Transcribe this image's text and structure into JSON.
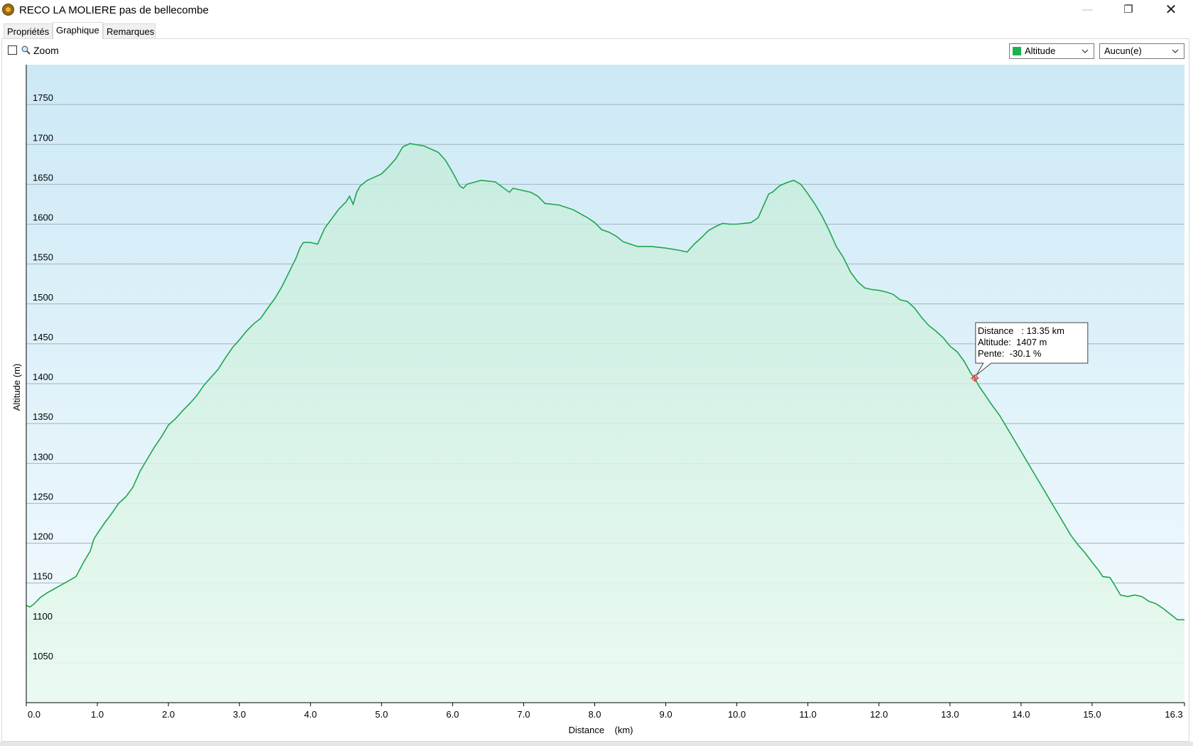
{
  "window": {
    "title": "RECO LA MOLIERE pas de bellecombe",
    "minimize": "—",
    "maximize": "❐",
    "close": "✕"
  },
  "tabs": [
    {
      "label": "Propriétés",
      "active": false
    },
    {
      "label": "Graphique",
      "active": true
    },
    {
      "label": "Remarques",
      "active": false
    }
  ],
  "toolbar": {
    "zoom_label": "Zoom",
    "zoom_checked": false,
    "series_select": {
      "value": "Altitude",
      "color": "#1bb24c"
    },
    "secondary_select": {
      "value": "Aucun(e)"
    }
  },
  "colors": {
    "line": "#1ea64a",
    "fill_top": "#c4ecda",
    "fill_bottom": "#eafaef",
    "bg_top": "#cde9f6",
    "bg_bottom": "#f4fbfe",
    "grid": "#9fb4bd",
    "marker": "#e03030"
  },
  "chart_data": {
    "type": "area",
    "xlabel": "Distance    (km)",
    "ylabel": "Altitude  (m)",
    "xlim": [
      0,
      16.3
    ],
    "ylim": [
      1000,
      1800
    ],
    "x_ticks": [
      "0.0",
      "1.0",
      "2.0",
      "3.0",
      "4.0",
      "5.0",
      "6.0",
      "7.0",
      "8.0",
      "9.0",
      "10.0",
      "11.0",
      "12.0",
      "13.0",
      "14.0",
      "15.0",
      "16.3"
    ],
    "y_ticks": [
      "1050",
      "1100",
      "1150",
      "1200",
      "1250",
      "1300",
      "1350",
      "1400",
      "1450",
      "1500",
      "1550",
      "1600",
      "1650",
      "1700",
      "1750"
    ],
    "grid": true,
    "series": [
      {
        "values": [
          [
            0.0,
            1122
          ],
          [
            0.05,
            1120
          ],
          [
            0.1,
            1123
          ],
          [
            0.2,
            1132
          ],
          [
            0.3,
            1138
          ],
          [
            0.4,
            1143
          ],
          [
            0.5,
            1148
          ],
          [
            0.6,
            1153
          ],
          [
            0.7,
            1158
          ],
          [
            0.8,
            1175
          ],
          [
            0.9,
            1190
          ],
          [
            0.95,
            1205
          ],
          [
            1.0,
            1212
          ],
          [
            1.1,
            1225
          ],
          [
            1.2,
            1237
          ],
          [
            1.3,
            1250
          ],
          [
            1.4,
            1258
          ],
          [
            1.5,
            1270
          ],
          [
            1.6,
            1290
          ],
          [
            1.7,
            1305
          ],
          [
            1.8,
            1320
          ],
          [
            1.9,
            1333
          ],
          [
            2.0,
            1348
          ],
          [
            2.1,
            1356
          ],
          [
            2.2,
            1366
          ],
          [
            2.3,
            1375
          ],
          [
            2.4,
            1385
          ],
          [
            2.5,
            1398
          ],
          [
            2.6,
            1408
          ],
          [
            2.7,
            1418
          ],
          [
            2.8,
            1432
          ],
          [
            2.9,
            1445
          ],
          [
            3.0,
            1455
          ],
          [
            3.1,
            1466
          ],
          [
            3.2,
            1475
          ],
          [
            3.3,
            1482
          ],
          [
            3.4,
            1495
          ],
          [
            3.5,
            1507
          ],
          [
            3.6,
            1522
          ],
          [
            3.7,
            1540
          ],
          [
            3.8,
            1558
          ],
          [
            3.85,
            1570
          ],
          [
            3.9,
            1577
          ],
          [
            4.0,
            1577
          ],
          [
            4.1,
            1575
          ],
          [
            4.15,
            1585
          ],
          [
            4.2,
            1595
          ],
          [
            4.3,
            1607
          ],
          [
            4.4,
            1619
          ],
          [
            4.5,
            1628
          ],
          [
            4.55,
            1635
          ],
          [
            4.6,
            1625
          ],
          [
            4.65,
            1640
          ],
          [
            4.7,
            1648
          ],
          [
            4.8,
            1655
          ],
          [
            5.0,
            1663
          ],
          [
            5.1,
            1672
          ],
          [
            5.2,
            1682
          ],
          [
            5.3,
            1697
          ],
          [
            5.4,
            1701
          ],
          [
            5.6,
            1698
          ],
          [
            5.8,
            1690
          ],
          [
            5.9,
            1680
          ],
          [
            6.0,
            1665
          ],
          [
            6.1,
            1648
          ],
          [
            6.15,
            1645
          ],
          [
            6.2,
            1650
          ],
          [
            6.4,
            1655
          ],
          [
            6.6,
            1653
          ],
          [
            6.8,
            1640
          ],
          [
            6.85,
            1645
          ],
          [
            7.0,
            1642
          ],
          [
            7.1,
            1640
          ],
          [
            7.2,
            1635
          ],
          [
            7.3,
            1626
          ],
          [
            7.5,
            1624
          ],
          [
            7.7,
            1618
          ],
          [
            7.9,
            1608
          ],
          [
            8.0,
            1602
          ],
          [
            8.1,
            1593
          ],
          [
            8.2,
            1590
          ],
          [
            8.3,
            1585
          ],
          [
            8.4,
            1578
          ],
          [
            8.6,
            1572
          ],
          [
            8.8,
            1572
          ],
          [
            9.0,
            1570
          ],
          [
            9.2,
            1567
          ],
          [
            9.3,
            1565
          ],
          [
            9.4,
            1575
          ],
          [
            9.5,
            1583
          ],
          [
            9.6,
            1592
          ],
          [
            9.7,
            1597
          ],
          [
            9.8,
            1601
          ],
          [
            9.9,
            1600
          ],
          [
            10.0,
            1600
          ],
          [
            10.2,
            1602
          ],
          [
            10.3,
            1608
          ],
          [
            10.4,
            1628
          ],
          [
            10.45,
            1638
          ],
          [
            10.5,
            1640
          ],
          [
            10.6,
            1648
          ],
          [
            10.7,
            1652
          ],
          [
            10.8,
            1655
          ],
          [
            10.9,
            1650
          ],
          [
            11.0,
            1638
          ],
          [
            11.1,
            1625
          ],
          [
            11.2,
            1610
          ],
          [
            11.3,
            1592
          ],
          [
            11.4,
            1572
          ],
          [
            11.5,
            1558
          ],
          [
            11.6,
            1540
          ],
          [
            11.7,
            1528
          ],
          [
            11.8,
            1520
          ],
          [
            11.9,
            1518
          ],
          [
            12.0,
            1517
          ],
          [
            12.1,
            1515
          ],
          [
            12.2,
            1512
          ],
          [
            12.3,
            1505
          ],
          [
            12.4,
            1503
          ],
          [
            12.5,
            1495
          ],
          [
            12.6,
            1483
          ],
          [
            12.7,
            1473
          ],
          [
            12.8,
            1466
          ],
          [
            12.9,
            1458
          ],
          [
            13.0,
            1447
          ],
          [
            13.1,
            1440
          ],
          [
            13.2,
            1428
          ],
          [
            13.3,
            1412
          ],
          [
            13.35,
            1407
          ],
          [
            13.4,
            1398
          ],
          [
            13.5,
            1385
          ],
          [
            13.6,
            1372
          ],
          [
            13.7,
            1360
          ],
          [
            13.8,
            1345
          ],
          [
            13.9,
            1330
          ],
          [
            14.0,
            1315
          ],
          [
            14.1,
            1300
          ],
          [
            14.2,
            1285
          ],
          [
            14.3,
            1270
          ],
          [
            14.4,
            1255
          ],
          [
            14.5,
            1240
          ],
          [
            14.6,
            1225
          ],
          [
            14.7,
            1210
          ],
          [
            14.8,
            1198
          ],
          [
            14.9,
            1188
          ],
          [
            15.0,
            1176
          ],
          [
            15.1,
            1165
          ],
          [
            15.15,
            1158
          ],
          [
            15.25,
            1157
          ],
          [
            15.3,
            1150
          ],
          [
            15.4,
            1135
          ],
          [
            15.5,
            1133
          ],
          [
            15.6,
            1135
          ],
          [
            15.7,
            1133
          ],
          [
            15.8,
            1127
          ],
          [
            15.9,
            1124
          ],
          [
            16.0,
            1118
          ],
          [
            16.1,
            1111
          ],
          [
            16.2,
            1104
          ],
          [
            16.3,
            1104
          ]
        ]
      }
    ],
    "tooltip": {
      "x": 13.35,
      "y": 1407,
      "line1": "Distance   : 13.35 km",
      "line2": "Altitude:  1407 m",
      "line3": "Pente:  -30.1 %"
    }
  }
}
